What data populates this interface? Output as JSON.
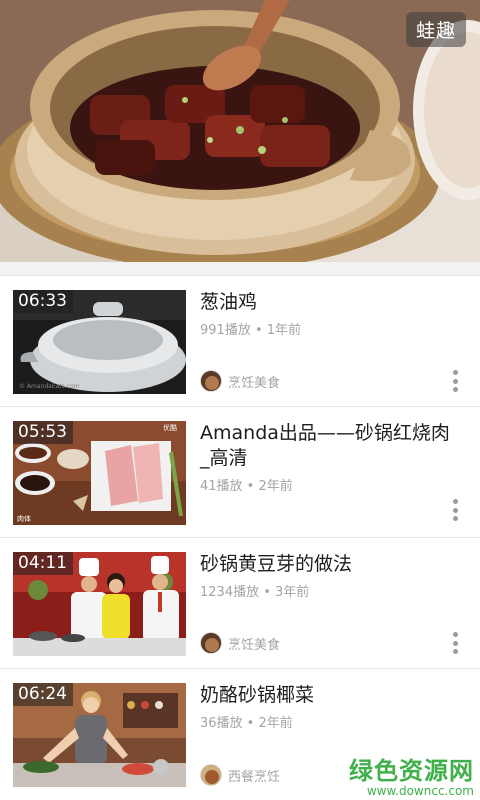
{
  "hero": {
    "logo_text": "蛙趣",
    "icon": "clay-pot-pork-photo"
  },
  "videos": [
    {
      "duration": "06:33",
      "title": "葱油鸡",
      "meta": "991播放 • 1年前",
      "author": "烹饪美食",
      "thumb_icon": "steel-pot-photo"
    },
    {
      "duration": "05:53",
      "title": "Amanda出品——砂锅红烧肉_高清",
      "meta": "41播放 • 2年前",
      "author": "",
      "thumb_icon": "raw-pork-ingredients-photo"
    },
    {
      "duration": "04:11",
      "title": "砂锅黄豆芽的做法",
      "meta": "1234播放 • 3年前",
      "author": "烹饪美食",
      "thumb_icon": "chefs-cooking-show-photo"
    },
    {
      "duration": "06:24",
      "title": "奶酪砂锅椰菜",
      "meta": "36播放 • 2年前",
      "author": "西餐烹饪",
      "thumb_icon": "kitchen-host-photo"
    }
  ],
  "watermark": {
    "brand": "绿色资源网",
    "url": "www.downcc.com"
  },
  "colors": {
    "watermark": "#3fb04a",
    "meta_text": "#a4a4a4",
    "title_text": "#1e1e1e"
  }
}
